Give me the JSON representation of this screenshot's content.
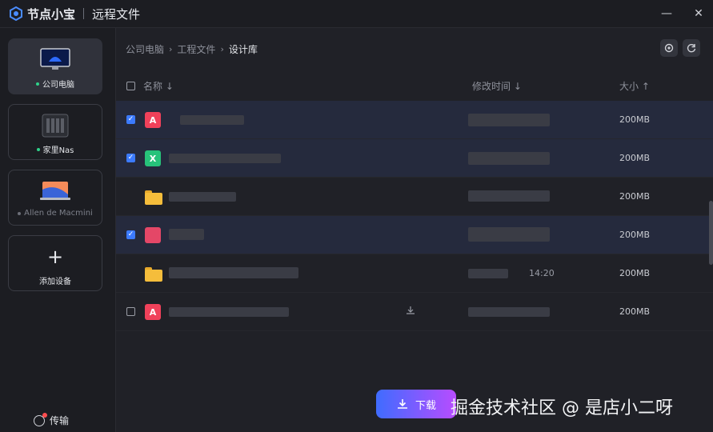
{
  "app": {
    "brand": "节点小宝",
    "window_title": "远程文件"
  },
  "window_controls": {
    "minimize": "—",
    "close": "✕"
  },
  "sidebar": {
    "devices": [
      {
        "label": "公司电脑",
        "status": "online",
        "icon": "desktop-icon",
        "active": true
      },
      {
        "label": "家里Nas",
        "status": "online",
        "icon": "nas-icon",
        "active": false
      },
      {
        "label": "Allen de Macmini",
        "status": "offline",
        "icon": "laptop-icon",
        "active": false
      }
    ],
    "add_device": {
      "plus": "+",
      "label": "添加设备"
    },
    "transfer_label": "传输"
  },
  "breadcrumb": {
    "items": [
      "公司电脑",
      "工程文件",
      "设计库"
    ],
    "separator": "›"
  },
  "table": {
    "headers": {
      "name": "名称",
      "modified": "修改时间",
      "size": "大小"
    },
    "sort_arrows": {
      "name": "↓",
      "modified": "↓",
      "size": "↑"
    },
    "rows": [
      {
        "type": "pdf",
        "checked": true,
        "selected": true,
        "name": "",
        "modified": "",
        "size": "200MB"
      },
      {
        "type": "xls",
        "checked": true,
        "selected": true,
        "name": "",
        "modified": "",
        "size": "200MB"
      },
      {
        "type": "folder",
        "checked": false,
        "selected": false,
        "name": "",
        "modified": "",
        "size": "200MB"
      },
      {
        "type": "pdf",
        "checked": true,
        "selected": true,
        "name": "",
        "modified": "",
        "size": "200MB"
      },
      {
        "type": "folder",
        "checked": false,
        "selected": false,
        "name": "",
        "modified": "14:20",
        "size": "200MB"
      },
      {
        "type": "pdf",
        "checked": false,
        "selected": false,
        "name": "",
        "modified": "",
        "size": "200MB"
      }
    ]
  },
  "download_button": {
    "label": "下载"
  },
  "watermark": "掘金技术社区 @ 是店小二呀",
  "colors": {
    "accent": "#3c7bff",
    "pdf": "#f0415a",
    "xls": "#27c27a",
    "folder": "#f5bd3b",
    "online": "#2fd18a"
  }
}
